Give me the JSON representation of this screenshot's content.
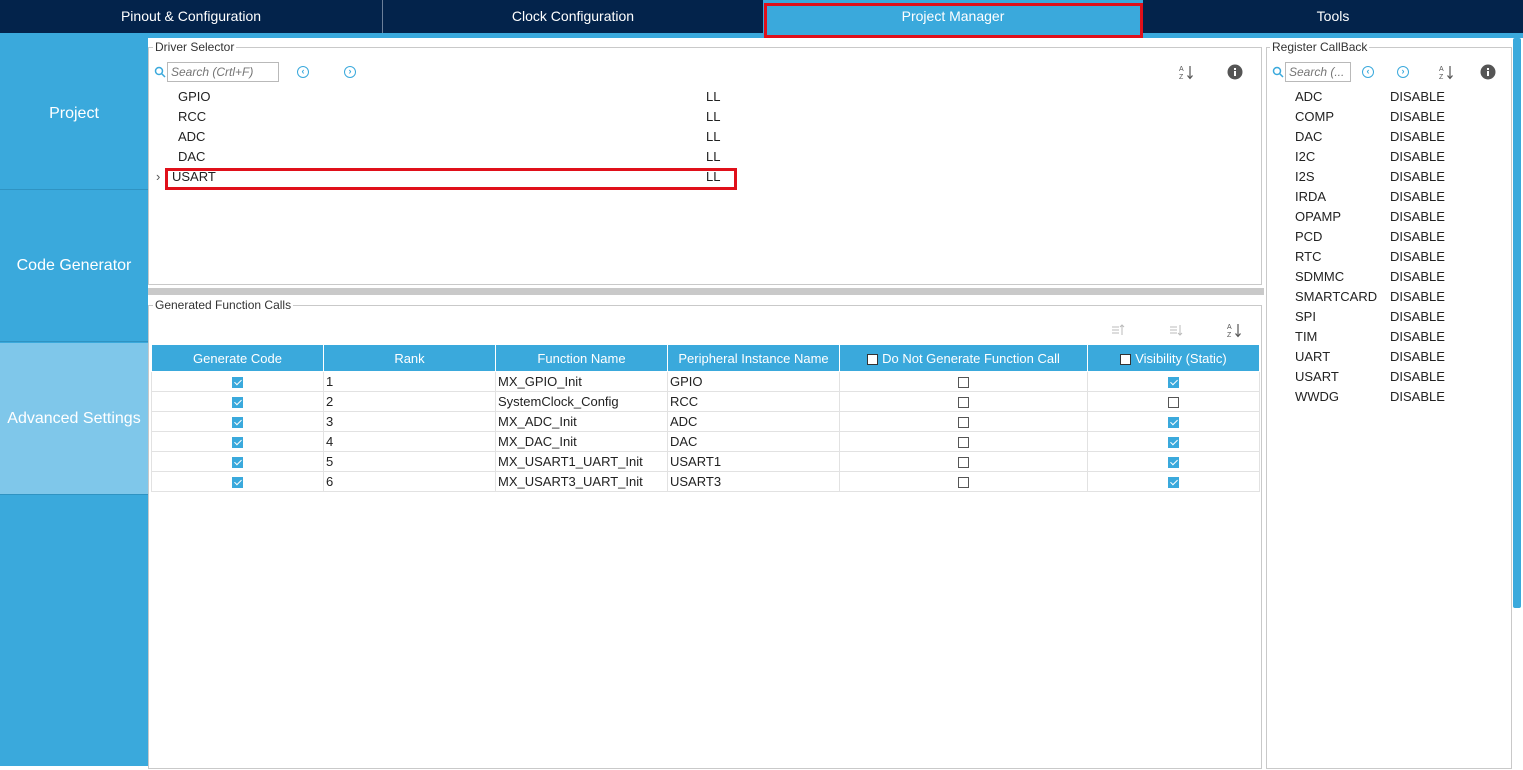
{
  "tabs": [
    {
      "label": "Pinout & Configuration"
    },
    {
      "label": "Clock Configuration"
    },
    {
      "label": "Project Manager"
    },
    {
      "label": "Tools"
    }
  ],
  "nav": [
    {
      "label": "Project"
    },
    {
      "label": "Code Generator"
    },
    {
      "label": "Advanced Settings"
    }
  ],
  "driver_selector": {
    "title": "Driver Selector",
    "search_placeholder": "Search (Crtl+F)",
    "rows": [
      {
        "name": "GPIO",
        "driver": "LL"
      },
      {
        "name": "RCC",
        "driver": "LL"
      },
      {
        "name": "ADC",
        "driver": "LL"
      },
      {
        "name": "DAC",
        "driver": "LL"
      },
      {
        "name": "USART",
        "driver": "LL"
      }
    ]
  },
  "generated_calls": {
    "title": "Generated Function Calls",
    "headers": {
      "generate": "Generate Code",
      "rank": "Rank",
      "function": "Function Name",
      "instance": "Peripheral Instance Name",
      "do_not_generate": "Do Not Generate Function Call",
      "visibility": "Visibility (Static)"
    },
    "rows": [
      {
        "generate": true,
        "rank": "1",
        "function": "MX_GPIO_Init",
        "instance": "GPIO",
        "do_not_generate": false,
        "visibility": true
      },
      {
        "generate": true,
        "rank": "2",
        "function": "SystemClock_Config",
        "instance": "RCC",
        "do_not_generate": false,
        "visibility": false
      },
      {
        "generate": true,
        "rank": "3",
        "function": "MX_ADC_Init",
        "instance": "ADC",
        "do_not_generate": false,
        "visibility": true
      },
      {
        "generate": true,
        "rank": "4",
        "function": "MX_DAC_Init",
        "instance": "DAC",
        "do_not_generate": false,
        "visibility": true
      },
      {
        "generate": true,
        "rank": "5",
        "function": "MX_USART1_UART_Init",
        "instance": "USART1",
        "do_not_generate": false,
        "visibility": true
      },
      {
        "generate": true,
        "rank": "6",
        "function": "MX_USART3_UART_Init",
        "instance": "USART3",
        "do_not_generate": false,
        "visibility": true
      }
    ]
  },
  "register_callback": {
    "title": "Register CallBack",
    "search_placeholder": "Search (...",
    "rows": [
      {
        "name": "ADC",
        "value": "DISABLE"
      },
      {
        "name": "COMP",
        "value": "DISABLE"
      },
      {
        "name": "DAC",
        "value": "DISABLE"
      },
      {
        "name": "I2C",
        "value": "DISABLE"
      },
      {
        "name": "I2S",
        "value": "DISABLE"
      },
      {
        "name": "IRDA",
        "value": "DISABLE"
      },
      {
        "name": "OPAMP",
        "value": "DISABLE"
      },
      {
        "name": "PCD",
        "value": "DISABLE"
      },
      {
        "name": "RTC",
        "value": "DISABLE"
      },
      {
        "name": "SDMMC",
        "value": "DISABLE"
      },
      {
        "name": "SMARTCARD",
        "value": "DISABLE"
      },
      {
        "name": "SPI",
        "value": "DISABLE"
      },
      {
        "name": "TIM",
        "value": "DISABLE"
      },
      {
        "name": "UART",
        "value": "DISABLE"
      },
      {
        "name": "USART",
        "value": "DISABLE"
      },
      {
        "name": "WWDG",
        "value": "DISABLE"
      }
    ]
  },
  "colors": {
    "accent": "#3aa9dc",
    "topbar": "#03234b",
    "highlight": "#e0101a"
  }
}
